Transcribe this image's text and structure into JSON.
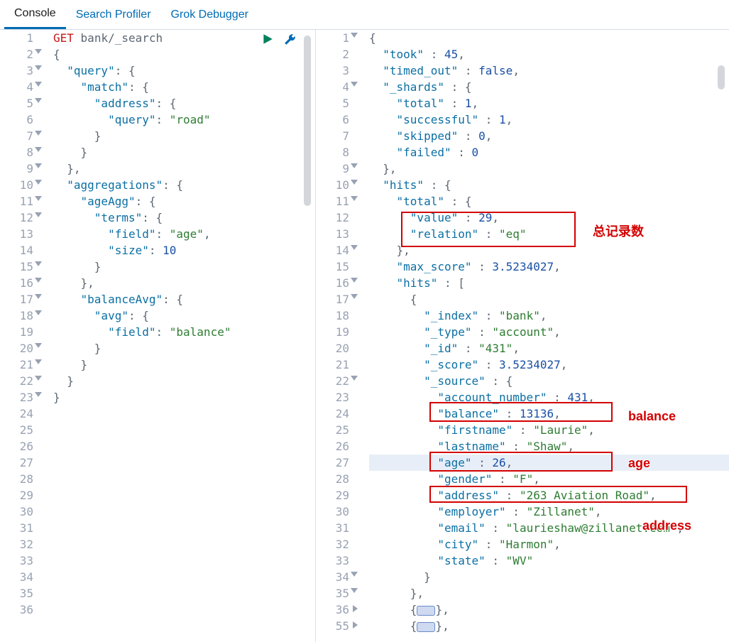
{
  "tabs": {
    "console": "Console",
    "profiler": "Search Profiler",
    "grok": "Grok Debugger"
  },
  "annotations": {
    "total_records": "总记录数",
    "balance": "balance",
    "age": "age",
    "address": "address"
  },
  "left_editor": {
    "method": "GET",
    "path": "bank/_search",
    "lines": [
      {
        "n": 1,
        "fold": null,
        "tokens": [
          [
            "method",
            "GET"
          ],
          [
            "space",
            " "
          ],
          [
            "path",
            "bank/_search"
          ]
        ]
      },
      {
        "n": 2,
        "fold": "open",
        "tokens": [
          [
            "punc",
            "{"
          ]
        ]
      },
      {
        "n": 3,
        "fold": "open",
        "tokens": [
          [
            "space",
            "  "
          ],
          [
            "key",
            "\"query\""
          ],
          [
            "punc",
            ": {"
          ]
        ]
      },
      {
        "n": 4,
        "fold": "open",
        "tokens": [
          [
            "space",
            "    "
          ],
          [
            "key",
            "\"match\""
          ],
          [
            "punc",
            ": {"
          ]
        ]
      },
      {
        "n": 5,
        "fold": "open",
        "tokens": [
          [
            "space",
            "      "
          ],
          [
            "key",
            "\"address\""
          ],
          [
            "punc",
            ": {"
          ]
        ]
      },
      {
        "n": 6,
        "fold": null,
        "tokens": [
          [
            "space",
            "        "
          ],
          [
            "key",
            "\"query\""
          ],
          [
            "punc",
            ": "
          ],
          [
            "str",
            "\"road\""
          ]
        ]
      },
      {
        "n": 7,
        "fold": "open",
        "tokens": [
          [
            "space",
            "      "
          ],
          [
            "punc",
            "}"
          ]
        ]
      },
      {
        "n": 8,
        "fold": "open",
        "tokens": [
          [
            "space",
            "    "
          ],
          [
            "punc",
            "}"
          ]
        ]
      },
      {
        "n": 9,
        "fold": "open",
        "tokens": [
          [
            "space",
            "  "
          ],
          [
            "punc",
            "},"
          ]
        ]
      },
      {
        "n": 10,
        "fold": "open",
        "tokens": [
          [
            "space",
            "  "
          ],
          [
            "key",
            "\"aggregations\""
          ],
          [
            "punc",
            ": {"
          ]
        ]
      },
      {
        "n": 11,
        "fold": "open",
        "tokens": [
          [
            "space",
            "    "
          ],
          [
            "key",
            "\"ageAgg\""
          ],
          [
            "punc",
            ": {"
          ]
        ]
      },
      {
        "n": 12,
        "fold": "open",
        "tokens": [
          [
            "space",
            "      "
          ],
          [
            "key",
            "\"terms\""
          ],
          [
            "punc",
            ": {"
          ]
        ]
      },
      {
        "n": 13,
        "fold": null,
        "tokens": [
          [
            "space",
            "        "
          ],
          [
            "key",
            "\"field\""
          ],
          [
            "punc",
            ": "
          ],
          [
            "str",
            "\"age\""
          ],
          [
            "punc",
            ","
          ]
        ]
      },
      {
        "n": 14,
        "fold": null,
        "tokens": [
          [
            "space",
            "        "
          ],
          [
            "key",
            "\"size\""
          ],
          [
            "punc",
            ": "
          ],
          [
            "num",
            "10"
          ]
        ]
      },
      {
        "n": 15,
        "fold": "open",
        "tokens": [
          [
            "space",
            "      "
          ],
          [
            "punc",
            "}"
          ]
        ]
      },
      {
        "n": 16,
        "fold": "open",
        "tokens": [
          [
            "space",
            "    "
          ],
          [
            "punc",
            "},"
          ]
        ]
      },
      {
        "n": 17,
        "fold": "open",
        "tokens": [
          [
            "space",
            "    "
          ],
          [
            "key",
            "\"balanceAvg\""
          ],
          [
            "punc",
            ": {"
          ]
        ]
      },
      {
        "n": 18,
        "fold": "open",
        "tokens": [
          [
            "space",
            "      "
          ],
          [
            "key",
            "\"avg\""
          ],
          [
            "punc",
            ": {"
          ]
        ]
      },
      {
        "n": 19,
        "fold": null,
        "tokens": [
          [
            "space",
            "        "
          ],
          [
            "key",
            "\"field\""
          ],
          [
            "punc",
            ": "
          ],
          [
            "str",
            "\"balance\""
          ]
        ]
      },
      {
        "n": 20,
        "fold": "open",
        "tokens": [
          [
            "space",
            "      "
          ],
          [
            "punc",
            "}"
          ]
        ]
      },
      {
        "n": 21,
        "fold": "open",
        "tokens": [
          [
            "space",
            "    "
          ],
          [
            "punc",
            "}"
          ]
        ]
      },
      {
        "n": 22,
        "fold": "open",
        "tokens": [
          [
            "space",
            "  "
          ],
          [
            "punc",
            "}"
          ]
        ]
      },
      {
        "n": 23,
        "fold": "open",
        "tokens": [
          [
            "punc",
            "}"
          ]
        ]
      },
      {
        "n": 24
      },
      {
        "n": 25
      },
      {
        "n": 26
      },
      {
        "n": 27
      },
      {
        "n": 28
      },
      {
        "n": 29
      },
      {
        "n": 30
      },
      {
        "n": 31
      },
      {
        "n": 32
      },
      {
        "n": 33
      },
      {
        "n": 34
      },
      {
        "n": 35
      },
      {
        "n": 36
      }
    ]
  },
  "right_editor": {
    "lines": [
      {
        "n": 1,
        "fold": "open",
        "tokens": [
          [
            "punc",
            "{"
          ]
        ]
      },
      {
        "n": 2,
        "fold": null,
        "tokens": [
          [
            "space",
            "  "
          ],
          [
            "key",
            "\"took\""
          ],
          [
            "punc",
            " : "
          ],
          [
            "num",
            "45"
          ],
          [
            "punc",
            ","
          ]
        ]
      },
      {
        "n": 3,
        "fold": null,
        "tokens": [
          [
            "space",
            "  "
          ],
          [
            "key",
            "\"timed_out\""
          ],
          [
            "punc",
            " : "
          ],
          [
            "bool",
            "false"
          ],
          [
            "punc",
            ","
          ]
        ]
      },
      {
        "n": 4,
        "fold": "open",
        "tokens": [
          [
            "space",
            "  "
          ],
          [
            "key",
            "\"_shards\""
          ],
          [
            "punc",
            " : {"
          ]
        ]
      },
      {
        "n": 5,
        "fold": null,
        "tokens": [
          [
            "space",
            "    "
          ],
          [
            "key",
            "\"total\""
          ],
          [
            "punc",
            " : "
          ],
          [
            "num",
            "1"
          ],
          [
            "punc",
            ","
          ]
        ]
      },
      {
        "n": 6,
        "fold": null,
        "tokens": [
          [
            "space",
            "    "
          ],
          [
            "key",
            "\"successful\""
          ],
          [
            "punc",
            " : "
          ],
          [
            "num",
            "1"
          ],
          [
            "punc",
            ","
          ]
        ]
      },
      {
        "n": 7,
        "fold": null,
        "tokens": [
          [
            "space",
            "    "
          ],
          [
            "key",
            "\"skipped\""
          ],
          [
            "punc",
            " : "
          ],
          [
            "num",
            "0"
          ],
          [
            "punc",
            ","
          ]
        ]
      },
      {
        "n": 8,
        "fold": null,
        "tokens": [
          [
            "space",
            "    "
          ],
          [
            "key",
            "\"failed\""
          ],
          [
            "punc",
            " : "
          ],
          [
            "num",
            "0"
          ]
        ]
      },
      {
        "n": 9,
        "fold": "open",
        "tokens": [
          [
            "space",
            "  "
          ],
          [
            "punc",
            "},"
          ]
        ]
      },
      {
        "n": 10,
        "fold": "open",
        "tokens": [
          [
            "space",
            "  "
          ],
          [
            "key",
            "\"hits\""
          ],
          [
            "punc",
            " : {"
          ]
        ]
      },
      {
        "n": 11,
        "fold": "open",
        "tokens": [
          [
            "space",
            "    "
          ],
          [
            "key",
            "\"total\""
          ],
          [
            "punc",
            " : {"
          ]
        ]
      },
      {
        "n": 12,
        "fold": null,
        "tokens": [
          [
            "space",
            "      "
          ],
          [
            "key",
            "\"value\""
          ],
          [
            "punc",
            " : "
          ],
          [
            "num",
            "29"
          ],
          [
            "punc",
            ","
          ]
        ]
      },
      {
        "n": 13,
        "fold": null,
        "tokens": [
          [
            "space",
            "      "
          ],
          [
            "key",
            "\"relation\""
          ],
          [
            "punc",
            " : "
          ],
          [
            "str",
            "\"eq\""
          ]
        ]
      },
      {
        "n": 14,
        "fold": "open",
        "tokens": [
          [
            "space",
            "    "
          ],
          [
            "punc",
            "},"
          ]
        ]
      },
      {
        "n": 15,
        "fold": null,
        "tokens": [
          [
            "space",
            "    "
          ],
          [
            "key",
            "\"max_score\""
          ],
          [
            "punc",
            " : "
          ],
          [
            "num",
            "3.5234027"
          ],
          [
            "punc",
            ","
          ]
        ]
      },
      {
        "n": 16,
        "fold": "open",
        "tokens": [
          [
            "space",
            "    "
          ],
          [
            "key",
            "\"hits\""
          ],
          [
            "punc",
            " : ["
          ]
        ]
      },
      {
        "n": 17,
        "fold": "open",
        "tokens": [
          [
            "space",
            "      "
          ],
          [
            "punc",
            "{"
          ]
        ]
      },
      {
        "n": 18,
        "fold": null,
        "tokens": [
          [
            "space",
            "        "
          ],
          [
            "key",
            "\"_index\""
          ],
          [
            "punc",
            " : "
          ],
          [
            "str",
            "\"bank\""
          ],
          [
            "punc",
            ","
          ]
        ]
      },
      {
        "n": 19,
        "fold": null,
        "tokens": [
          [
            "space",
            "        "
          ],
          [
            "key",
            "\"_type\""
          ],
          [
            "punc",
            " : "
          ],
          [
            "str",
            "\"account\""
          ],
          [
            "punc",
            ","
          ]
        ]
      },
      {
        "n": 20,
        "fold": null,
        "tokens": [
          [
            "space",
            "        "
          ],
          [
            "key",
            "\"_id\""
          ],
          [
            "punc",
            " : "
          ],
          [
            "str",
            "\"431\""
          ],
          [
            "punc",
            ","
          ]
        ]
      },
      {
        "n": 21,
        "fold": null,
        "tokens": [
          [
            "space",
            "        "
          ],
          [
            "key",
            "\"_score\""
          ],
          [
            "punc",
            " : "
          ],
          [
            "num",
            "3.5234027"
          ],
          [
            "punc",
            ","
          ]
        ]
      },
      {
        "n": 22,
        "fold": "open",
        "tokens": [
          [
            "space",
            "        "
          ],
          [
            "key",
            "\"_source\""
          ],
          [
            "punc",
            " : {"
          ]
        ]
      },
      {
        "n": 23,
        "fold": null,
        "tokens": [
          [
            "space",
            "          "
          ],
          [
            "key",
            "\"account_number\""
          ],
          [
            "punc",
            " : "
          ],
          [
            "num",
            "431"
          ],
          [
            "punc",
            ","
          ]
        ]
      },
      {
        "n": 24,
        "fold": null,
        "tokens": [
          [
            "space",
            "          "
          ],
          [
            "key",
            "\"balance\""
          ],
          [
            "punc",
            " : "
          ],
          [
            "num",
            "13136"
          ],
          [
            "punc",
            ","
          ]
        ]
      },
      {
        "n": 25,
        "fold": null,
        "tokens": [
          [
            "space",
            "          "
          ],
          [
            "key",
            "\"firstname\""
          ],
          [
            "punc",
            " : "
          ],
          [
            "str",
            "\"Laurie\""
          ],
          [
            "punc",
            ","
          ]
        ]
      },
      {
        "n": 26,
        "fold": null,
        "tokens": [
          [
            "space",
            "          "
          ],
          [
            "key",
            "\"lastname\""
          ],
          [
            "punc",
            " : "
          ],
          [
            "str",
            "\"Shaw\""
          ],
          [
            "punc",
            ","
          ]
        ]
      },
      {
        "n": 27,
        "fold": null,
        "hl": true,
        "tokens": [
          [
            "space",
            "          "
          ],
          [
            "key",
            "\"age\""
          ],
          [
            "punc",
            " : "
          ],
          [
            "num",
            "26"
          ],
          [
            "punc",
            ","
          ]
        ]
      },
      {
        "n": 28,
        "fold": null,
        "tokens": [
          [
            "space",
            "          "
          ],
          [
            "key",
            "\"gender\""
          ],
          [
            "punc",
            " : "
          ],
          [
            "str",
            "\"F\""
          ],
          [
            "punc",
            ","
          ]
        ]
      },
      {
        "n": 29,
        "fold": null,
        "tokens": [
          [
            "space",
            "          "
          ],
          [
            "key",
            "\"address\""
          ],
          [
            "punc",
            " : "
          ],
          [
            "str",
            "\"263 Aviation Road\""
          ],
          [
            "punc",
            ","
          ]
        ]
      },
      {
        "n": 30,
        "fold": null,
        "tokens": [
          [
            "space",
            "          "
          ],
          [
            "key",
            "\"employer\""
          ],
          [
            "punc",
            " : "
          ],
          [
            "str",
            "\"Zillanet\""
          ],
          [
            "punc",
            ","
          ]
        ]
      },
      {
        "n": 31,
        "fold": null,
        "tokens": [
          [
            "space",
            "          "
          ],
          [
            "key",
            "\"email\""
          ],
          [
            "punc",
            " : "
          ],
          [
            "str",
            "\"laurieshaw@zillanet.com\""
          ],
          [
            "punc",
            ","
          ]
        ]
      },
      {
        "n": 32,
        "fold": null,
        "tokens": [
          [
            "space",
            "          "
          ],
          [
            "key",
            "\"city\""
          ],
          [
            "punc",
            " : "
          ],
          [
            "str",
            "\"Harmon\""
          ],
          [
            "punc",
            ","
          ]
        ]
      },
      {
        "n": 33,
        "fold": null,
        "tokens": [
          [
            "space",
            "          "
          ],
          [
            "key",
            "\"state\""
          ],
          [
            "punc",
            " : "
          ],
          [
            "str",
            "\"WV\""
          ]
        ]
      },
      {
        "n": 34,
        "fold": "open",
        "tokens": [
          [
            "space",
            "        "
          ],
          [
            "punc",
            "}"
          ]
        ]
      },
      {
        "n": 35,
        "fold": "open",
        "tokens": [
          [
            "space",
            "      "
          ],
          [
            "punc",
            "},"
          ]
        ]
      },
      {
        "n": 36,
        "fold": "closed",
        "tokens": [
          [
            "space",
            "      "
          ],
          [
            "punc",
            "{"
          ],
          [
            "collapsed",
            ""
          ],
          [
            "punc",
            "},"
          ]
        ]
      },
      {
        "n": 55,
        "fold": "closed",
        "tokens": [
          [
            "space",
            "      "
          ],
          [
            "punc",
            "{"
          ],
          [
            "collapsed",
            ""
          ],
          [
            "punc",
            "},"
          ]
        ]
      }
    ]
  }
}
